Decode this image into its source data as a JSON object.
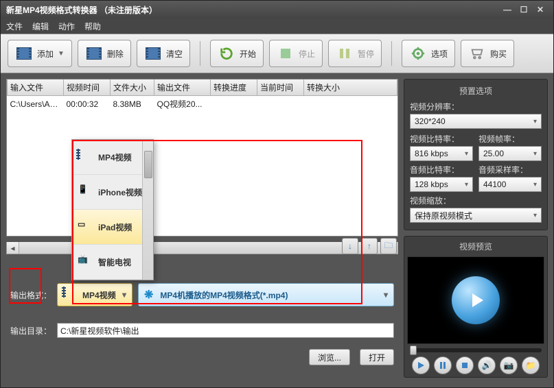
{
  "window": {
    "title": "新星MP4视频格式转换器 （未注册版本）"
  },
  "menu": {
    "file": "文件",
    "edit": "编辑",
    "action": "动作",
    "help": "帮助"
  },
  "toolbar": {
    "add": "添加",
    "delete": "删除",
    "clear": "清空",
    "start": "开始",
    "stop": "停止",
    "pause": "暂停",
    "options": "选项",
    "buy": "购买"
  },
  "table": {
    "headers": {
      "input": "输入文件",
      "vtime": "视频时间",
      "fsize": "文件大小",
      "output": "输出文件",
      "progress": "转换进度",
      "curtime": "当前时间",
      "csize": "转换大小"
    },
    "rows": [
      {
        "input": "C:\\Users\\Ad...",
        "vtime": "00:00:32",
        "fsize": "8.38MB",
        "output": "QQ视频20...",
        "progress": "",
        "curtime": "",
        "csize": ""
      }
    ]
  },
  "popup": {
    "items": [
      "MP4视频",
      "iPhone视频",
      "iPad视频",
      "智能电视"
    ],
    "selectedIndex": 2
  },
  "output": {
    "formatLabel": "输出格式：",
    "formatValue": "MP4视频",
    "profileValue": "MP4机播放的MP4视频格式(*.mp4)",
    "dirLabel": "输出目录：",
    "dirValue": "C:\\新星视频软件\\输出",
    "browse": "浏览...",
    "open": "打开"
  },
  "presets": {
    "title": "预置选项",
    "resLabel": "视频分辨率：",
    "resValue": "320*240",
    "vbitLabel": "视频比特率：",
    "vbitValue": "816 kbps",
    "vfpsLabel": "视频帧率：",
    "vfpsValue": "25.00",
    "abitLabel": "音频比特率：",
    "abitValue": "128 kbps",
    "asrLabel": "音频采样率：",
    "asrValue": "44100",
    "zoomLabel": "视频缩放：",
    "zoomValue": "保持原视频模式"
  },
  "preview": {
    "title": "视频预览"
  }
}
